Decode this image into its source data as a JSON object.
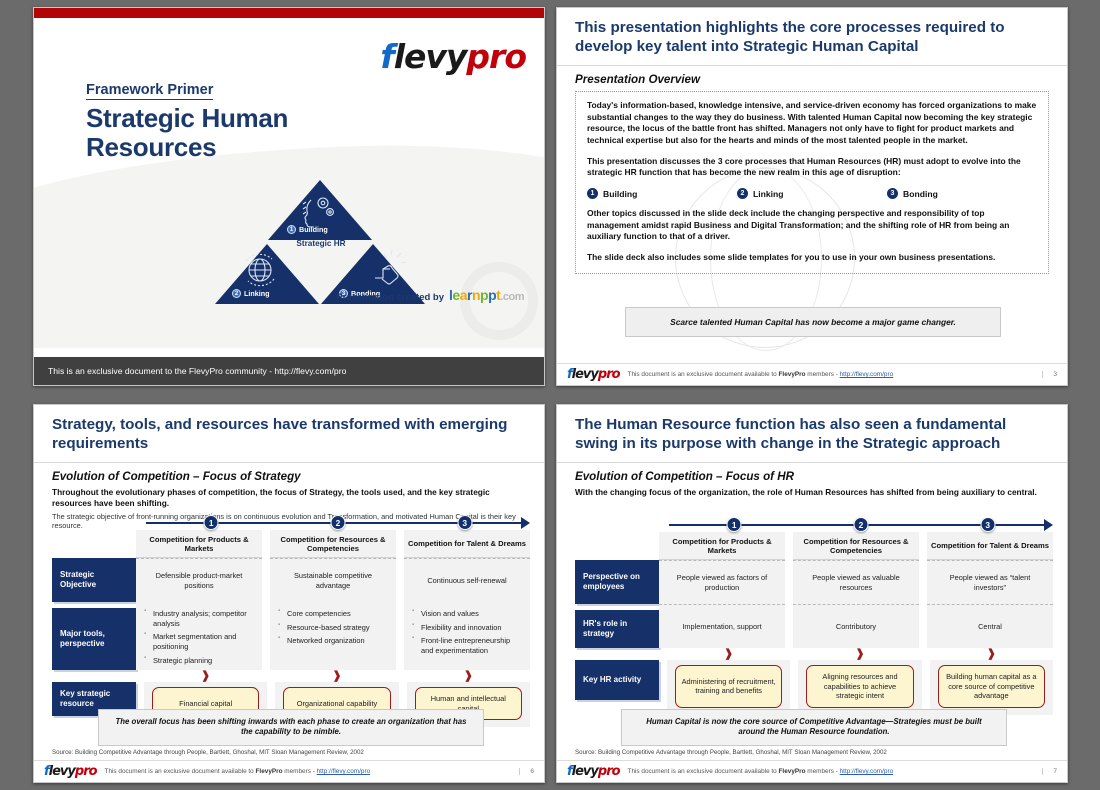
{
  "brand": {
    "logo_f": "f",
    "logo_levy": "levy",
    "logo_pro": "pro",
    "navy": "#1b3a6b",
    "red": "#b00607",
    "accent_blue": "#1169c9"
  },
  "slide_title": {
    "kicker": "Framework Primer",
    "title_line1": "Strategic Human",
    "title_line2": "Resources",
    "created_by_label": "Presentation created by",
    "learnppt": {
      "l": "l",
      "e": "e",
      "a": "a",
      "r": "r",
      "n": "n",
      "p": "p",
      "p2": "p",
      "t": "t",
      "com": ".com"
    },
    "triangle": {
      "center_label": "Strategic HR",
      "nodes": [
        {
          "num": "1",
          "label": "Building",
          "icon": "head-gears-icon"
        },
        {
          "num": "2",
          "label": "Linking",
          "icon": "globe-network-icon"
        },
        {
          "num": "3",
          "label": "Bonding",
          "icon": "handshake-icon"
        }
      ]
    },
    "footer": "This is an exclusive document to the FlevyPro community - http://flevy.com/pro",
    "footer_bold": "FlevyPro"
  },
  "slide_overview": {
    "heading": "This presentation highlights the core processes required to develop key talent into Strategic Human Capital",
    "subheading": "Presentation Overview",
    "paragraphs": [
      "Today's information-based, knowledge intensive, and service-driven economy has forced organizations to make substantial changes to the way they do business.  With talented Human Capital now becoming the key strategic resource, the locus of the battle front has shifted.  Managers not only have to fight for product markets and technical expertise but also for the hearts and minds of the most talented people in the market.",
      "This presentation discusses the 3 core processes that Human Resources (HR) must adopt to evolve into the strategic HR function that has become the new realm in this age of disruption:"
    ],
    "steps": [
      {
        "num": "1",
        "label": "Building"
      },
      {
        "num": "2",
        "label": "Linking"
      },
      {
        "num": "3",
        "label": "Bonding"
      }
    ],
    "paragraphs_after": [
      "Other topics discussed in the slide deck include the changing perspective and responsibility of top management amidst rapid Business and Digital Transformation; and the shifting role of HR from being an auxiliary function to that of a driver.",
      "The slide deck also includes some slide templates for you to use in your own business presentations."
    ],
    "callout": "Scarce talented Human Capital has now become a major game changer.",
    "footer_text_1": "This document is an exclusive document available to ",
    "footer_bold": "FlevyPro",
    "footer_text_2": " members - ",
    "footer_link": "http://flevy.com/pro",
    "page_no": "3"
  },
  "slide_strategy": {
    "heading": "Strategy, tools, and resources have transformed with emerging requirements",
    "subheading": "Evolution of Competition – Focus of Strategy",
    "lead": "Throughout the evolutionary phases of competition, the focus of Strategy, the tools used, and the key strategic resources have been shifting.",
    "lead2": "The strategic objective of front-running organizations is on continuous evolution and Transformation, and motivated Human Capital is their key resource.",
    "phases": [
      {
        "num": "1",
        "title": "Competition for Products & Markets"
      },
      {
        "num": "2",
        "title": "Competition for Resources & Competencies"
      },
      {
        "num": "3",
        "title": "Competition for Talent & Dreams"
      }
    ],
    "rows": [
      {
        "label": "Strategic Objective",
        "cells": [
          {
            "text": "Defensible product-market positions"
          },
          {
            "text": "Sustainable competitive advantage"
          },
          {
            "text": "Continuous self-renewal"
          }
        ]
      },
      {
        "label": "Major tools, perspective",
        "cells": [
          {
            "bullets": [
              "Industry analysis; competitor analysis",
              "Market segmentation and positioning",
              "Strategic planning"
            ]
          },
          {
            "bullets": [
              "Core competencies",
              "Resource-based strategy",
              "Networked organization"
            ]
          },
          {
            "bullets": [
              "Vision and values",
              "Flexibility and innovation",
              "Front-line entrepreneurship and experimentation"
            ]
          }
        ]
      }
    ],
    "pill_row": {
      "label": "Key strategic resource",
      "pills": [
        "Financial capital",
        "Organizational capability",
        "Human and intellectual capital"
      ]
    },
    "callout": "The overall focus has been shifting inwards with each phase to create an organization that has the capability to be nimble.",
    "source": "Source: Building Competitive Advantage through People, Bartlett, Ghoshal, MIT Sloan Management Review, 2002",
    "footer_text_1": "This document is an exclusive document available to ",
    "footer_bold": "FlevyPro",
    "footer_text_2": " members - ",
    "footer_link": "http://flevy.com/pro",
    "page_no": "6"
  },
  "slide_hr": {
    "heading": "The Human Resource function has also seen a fundamental swing in its purpose with change in the Strategic approach",
    "subheading": "Evolution of Competition – Focus of HR",
    "lead": "With the changing focus of the organization, the role of Human Resources has shifted from being auxiliary to central.",
    "phases": [
      {
        "num": "1",
        "title": "Competition for Products & Markets"
      },
      {
        "num": "2",
        "title": "Competition for Resources & Competencies"
      },
      {
        "num": "3",
        "title": "Competition for Talent & Dreams"
      }
    ],
    "rows": [
      {
        "label": "Perspective on employees",
        "cells": [
          {
            "text": "People viewed as factors of production"
          },
          {
            "text": "People viewed as valuable resources"
          },
          {
            "text": "People viewed as “talent investors”"
          }
        ]
      },
      {
        "label": "HR's role in strategy",
        "cells": [
          {
            "text": "Implementation, support"
          },
          {
            "text": "Contributory"
          },
          {
            "text": "Central"
          }
        ]
      }
    ],
    "pill_row": {
      "label": "Key HR activity",
      "pills": [
        "Administering of recruitment, training and benefits",
        "Aligning resources and capabilities to achieve strategic intent",
        "Building human capital as a core source of competitive advantage"
      ]
    },
    "callout": "Human Capital is now the core source of Competitive Advantage—Strategies must be built around the Human Resource foundation.",
    "source": "Source: Building Competitive Advantage through People, Bartlett, Ghoshal, MIT Sloan Management Review, 2002",
    "footer_text_1": "This document is an exclusive document available to ",
    "footer_bold": "FlevyPro",
    "footer_text_2": " members - ",
    "footer_link": "http://flevy.com/pro",
    "page_no": "7"
  }
}
